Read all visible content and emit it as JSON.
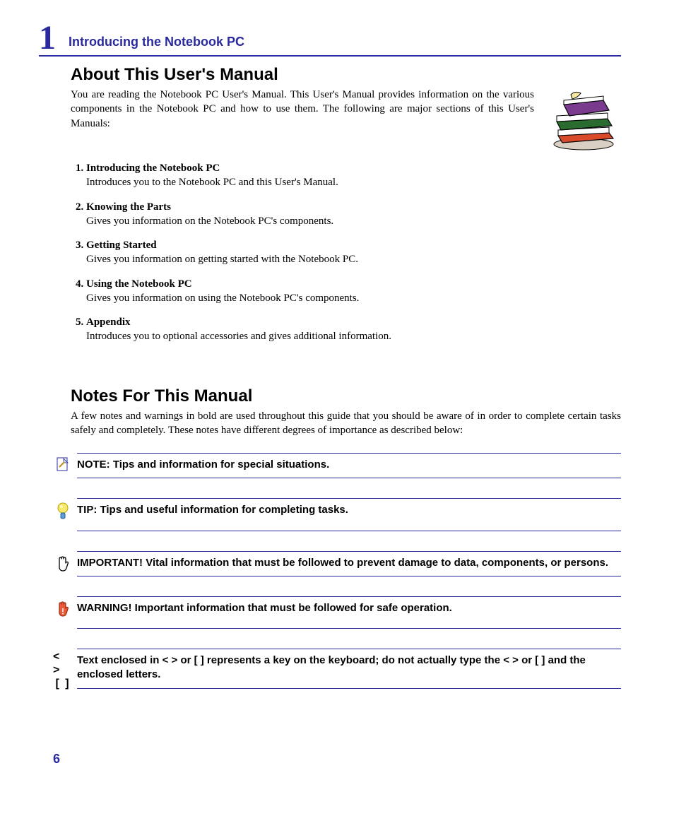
{
  "chapter": {
    "number": "1",
    "title": "Introducing the Notebook PC"
  },
  "heading1": "About This User's Manual",
  "intro": "You are reading the Notebook PC User's Manual. This User's Manual provides information on the various components in the Notebook PC and how to use them. The following are major sections of this User's Manuals:",
  "sections": [
    {
      "title": "Introducing the Notebook PC",
      "desc": "Introduces you to the Notebook PC and this User's Manual."
    },
    {
      "title": "Knowing the Parts",
      "desc": "Gives you information on the Notebook PC's components."
    },
    {
      "title": "Getting Started",
      "desc": "Gives you information on getting started with the Notebook PC."
    },
    {
      "title": "Using the Notebook PC",
      "desc": "Gives you information on using the Notebook PC's components."
    },
    {
      "title": "Appendix",
      "desc": "Introduces you to optional accessories and gives additional information."
    }
  ],
  "heading2": "Notes For This Manual",
  "notes_intro": "A few notes and warnings in bold are used throughout this guide that you should be aware of in order to complete certain tasks safely and completely. These notes have different degrees of importance as described below:",
  "callouts": {
    "note": "NOTE: Tips and information for special situations.",
    "tip": "TIP: Tips and useful information for completing tasks.",
    "important": "IMPORTANT! Vital information that must be followed to prevent damage to data, components, or persons.",
    "warning": "WARNING! Important information that must be followed for safe operation.",
    "keys": "Text enclosed in < > or [ ] represents a key on the keyboard; do not actually type the < > or [ ] and the enclosed letters."
  },
  "key_symbols": {
    "angle": "< >",
    "square": "[  ]"
  },
  "page_number": "6"
}
